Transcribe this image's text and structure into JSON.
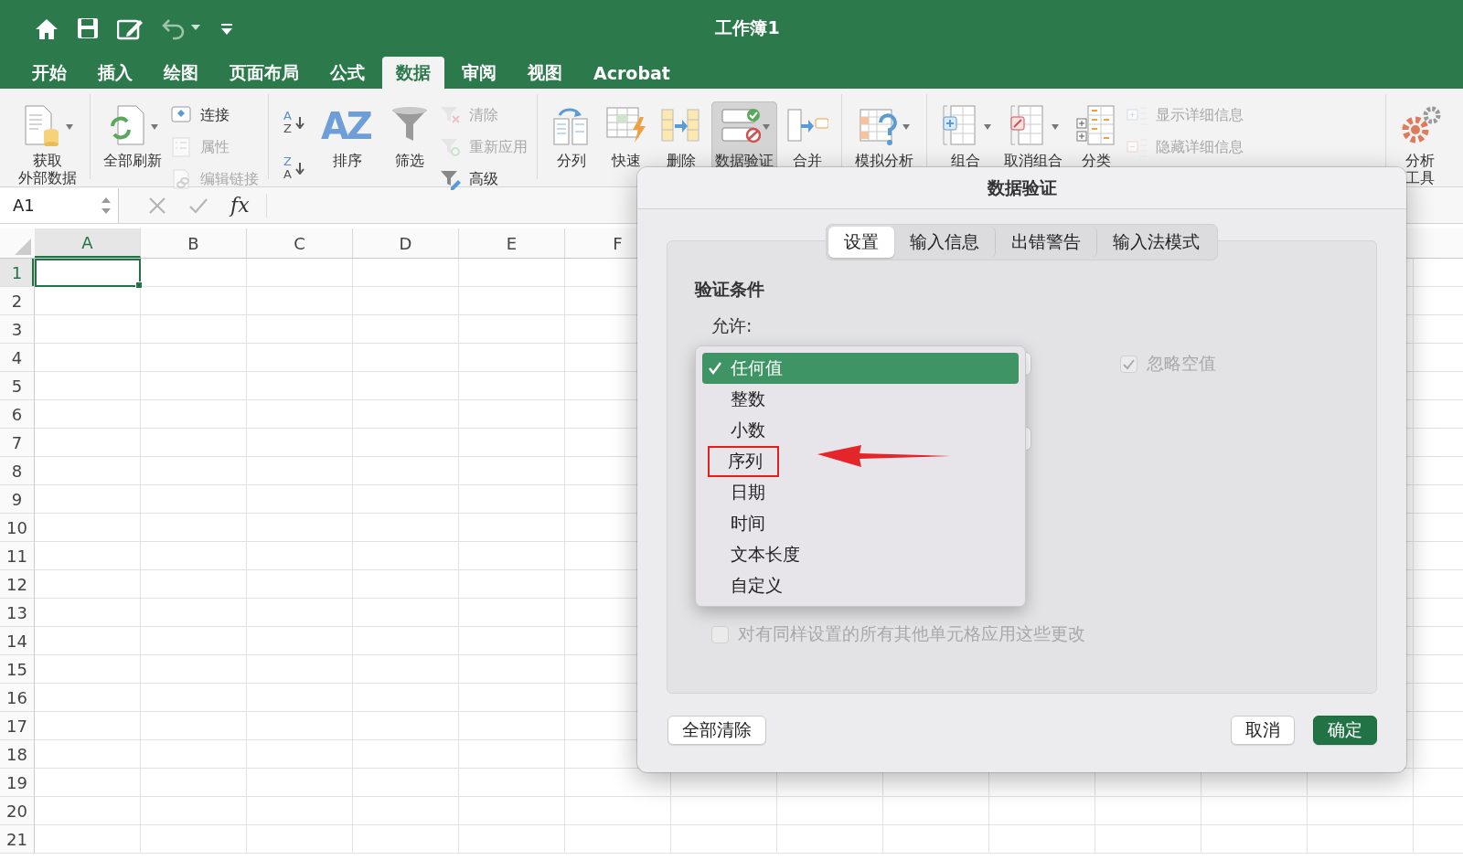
{
  "window": {
    "title": "工作簿1"
  },
  "menu_tabs": [
    {
      "label": "开始",
      "selected": false
    },
    {
      "label": "插入",
      "selected": false
    },
    {
      "label": "绘图",
      "selected": false
    },
    {
      "label": "页面布局",
      "selected": false
    },
    {
      "label": "公式",
      "selected": false
    },
    {
      "label": "数据",
      "selected": true
    },
    {
      "label": "审阅",
      "selected": false
    },
    {
      "label": "视图",
      "selected": false
    },
    {
      "label": "Acrobat",
      "selected": false
    }
  ],
  "ribbon_groups": [
    {
      "items": [
        {
          "kind": "large",
          "label": "获取",
          "label_2": "外部数据",
          "dropdown": true,
          "pressed": false
        }
      ]
    },
    {
      "items": [
        {
          "kind": "large",
          "label": "全部刷新",
          "dropdown": true,
          "pressed": false
        },
        {
          "kind": "small",
          "label": "连接",
          "disabled": false
        },
        {
          "kind": "small",
          "label": "属性",
          "disabled": true
        },
        {
          "kind": "small",
          "label": "编辑链接",
          "disabled": true
        }
      ]
    },
    {
      "items": [
        {
          "kind": "sort",
          "glyph_top": "A",
          "glyph_bottom": "Z"
        },
        {
          "kind": "sort",
          "glyph_top": "Z",
          "glyph_bottom": "A"
        },
        {
          "kind": "large",
          "label": "排序",
          "glyph": "AZ",
          "dropdown": false,
          "pressed": false
        },
        {
          "kind": "large",
          "label": "筛选",
          "dropdown": false,
          "pressed": false
        },
        {
          "kind": "small",
          "label": "清除",
          "disabled": true
        },
        {
          "kind": "small",
          "label": "重新应用",
          "disabled": true
        },
        {
          "kind": "small",
          "label": "高级",
          "disabled": false
        }
      ]
    },
    {
      "items": [
        {
          "kind": "large",
          "label": "分列",
          "dropdown": false,
          "pressed": false
        },
        {
          "kind": "large",
          "label": "快速",
          "dropdown": false,
          "pressed": false
        },
        {
          "kind": "large",
          "label": "删除",
          "dropdown": false,
          "pressed": false
        },
        {
          "kind": "large",
          "label": "数据验证",
          "dropdown": true,
          "pressed": true
        },
        {
          "kind": "large",
          "label": "合并",
          "dropdown": false,
          "pressed": false
        }
      ]
    },
    {
      "items": [
        {
          "kind": "large",
          "label": "模拟分析",
          "dropdown": true,
          "pressed": false
        }
      ]
    },
    {
      "items": [
        {
          "kind": "large",
          "label": "组合",
          "dropdown": true,
          "pressed": false
        },
        {
          "kind": "large",
          "label": "取消组合",
          "dropdown": true,
          "pressed": false
        },
        {
          "kind": "large",
          "label": "分类",
          "dropdown": false,
          "pressed": false
        },
        {
          "kind": "small",
          "label": "显示详细信息",
          "disabled": true
        },
        {
          "kind": "small",
          "label": "隐藏详细信息",
          "disabled": true
        }
      ]
    },
    {
      "items": [
        {
          "kind": "large",
          "label": "分析",
          "label_2": "工具",
          "dropdown": false,
          "pressed": false
        }
      ]
    }
  ],
  "formula_bar": {
    "name_box": "A1",
    "function_glyph": "fx"
  },
  "sheet": {
    "columns": [
      {
        "label": "A",
        "selected": true
      },
      {
        "label": "B",
        "selected": false
      },
      {
        "label": "C",
        "selected": false
      },
      {
        "label": "D",
        "selected": false
      },
      {
        "label": "E",
        "selected": false
      },
      {
        "label": "F",
        "selected": false
      }
    ],
    "rows": [
      {
        "label": "1",
        "selected": true
      },
      {
        "label": "2",
        "selected": false
      },
      {
        "label": "3",
        "selected": false
      },
      {
        "label": "4",
        "selected": false
      },
      {
        "label": "5",
        "selected": false
      },
      {
        "label": "6",
        "selected": false
      },
      {
        "label": "7",
        "selected": false
      },
      {
        "label": "8",
        "selected": false
      },
      {
        "label": "9",
        "selected": false
      },
      {
        "label": "10",
        "selected": false
      },
      {
        "label": "11",
        "selected": false
      },
      {
        "label": "12",
        "selected": false
      },
      {
        "label": "13",
        "selected": false
      },
      {
        "label": "14",
        "selected": false
      },
      {
        "label": "15",
        "selected": false
      },
      {
        "label": "16",
        "selected": false
      },
      {
        "label": "17",
        "selected": false
      },
      {
        "label": "18",
        "selected": false
      },
      {
        "label": "19",
        "selected": false
      },
      {
        "label": "20",
        "selected": false
      },
      {
        "label": "21",
        "selected": false
      }
    ]
  },
  "dialog": {
    "title": "数据验证",
    "tabs": [
      {
        "label": "设置",
        "selected": true
      },
      {
        "label": "输入信息",
        "selected": false
      },
      {
        "label": "出错警告",
        "selected": false
      },
      {
        "label": "输入法模式",
        "selected": false
      }
    ],
    "section_title": "验证条件",
    "allow_label": "允许:",
    "allow_options": [
      {
        "label": "任何值",
        "selected": true,
        "highlighted": false
      },
      {
        "label": "整数",
        "selected": false,
        "highlighted": false
      },
      {
        "label": "小数",
        "selected": false,
        "highlighted": false
      },
      {
        "label": "序列",
        "selected": false,
        "highlighted": true
      },
      {
        "label": "日期",
        "selected": false,
        "highlighted": false
      },
      {
        "label": "时间",
        "selected": false,
        "highlighted": false
      },
      {
        "label": "文本长度",
        "selected": false,
        "highlighted": false
      },
      {
        "label": "自定义",
        "selected": false,
        "highlighted": false
      }
    ],
    "annotation_arrow": true,
    "ignore_blank": {
      "label": "忽略空值",
      "checked": true,
      "disabled": true
    },
    "apply_all": {
      "label": "对有同样设置的所有其他单元格应用这些更改",
      "checked": false,
      "disabled": true
    },
    "buttons": [
      {
        "label": "全部清除",
        "kind": "plain"
      },
      {
        "label": "取消",
        "kind": "plain"
      },
      {
        "label": "确定",
        "kind": "default"
      }
    ]
  }
}
